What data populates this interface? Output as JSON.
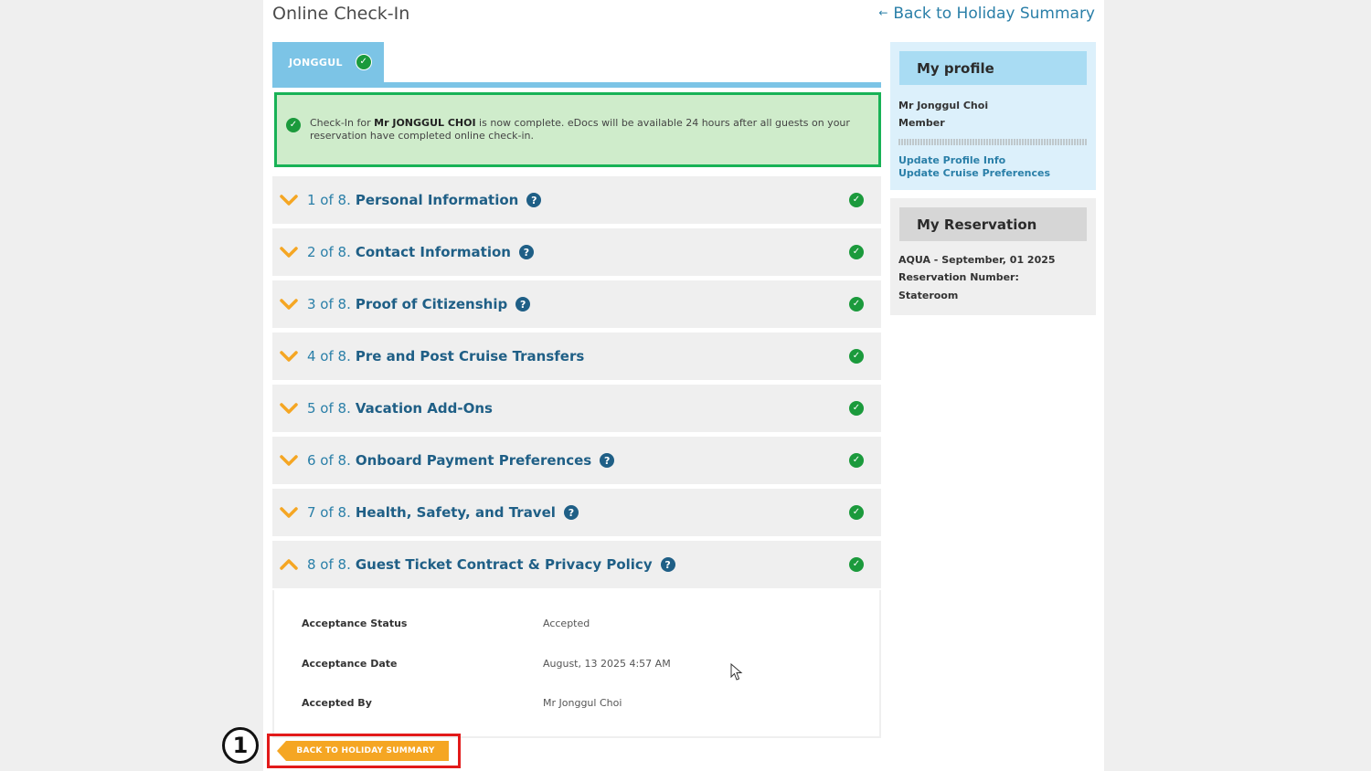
{
  "page": {
    "title": "Online Check-In",
    "back_link": "Back to Holiday Summary"
  },
  "guest_tab": {
    "label": "JONGGUL"
  },
  "banner": {
    "prefix": "Check-In for ",
    "guest_name": "Mr JONGGUL CHOI",
    "suffix": " is now complete. eDocs will be available 24 hours after all guests on your reservation have completed online check-in."
  },
  "steps": [
    {
      "num": "1 of 8.",
      "title": "Personal Information",
      "help": true
    },
    {
      "num": "2 of 8.",
      "title": "Contact Information",
      "help": true
    },
    {
      "num": "3 of 8.",
      "title": "Proof of Citizenship",
      "help": true
    },
    {
      "num": "4 of 8.",
      "title": "Pre and Post Cruise Transfers",
      "help": false
    },
    {
      "num": "5 of 8.",
      "title": "Vacation Add-Ons",
      "help": false
    },
    {
      "num": "6 of 8.",
      "title": "Onboard Payment Preferences",
      "help": true
    },
    {
      "num": "7 of 8.",
      "title": "Health, Safety, and Travel",
      "help": true
    },
    {
      "num": "8 of 8.",
      "title": "Guest Ticket Contract & Privacy Policy",
      "help": true,
      "expanded": true
    }
  ],
  "details": {
    "acceptance_status_label": "Acceptance Status",
    "acceptance_status_value": "Accepted",
    "acceptance_date_label": "Acceptance Date",
    "acceptance_date_value": "August, 13 2025 4:57 AM",
    "accepted_by_label": "Accepted By",
    "accepted_by_value": "Mr Jonggul Choi"
  },
  "bottom_button": {
    "label": "BACK TO HOLIDAY SUMMARY",
    "marker": "1"
  },
  "profile": {
    "title": "My profile",
    "name": "Mr Jonggul Choi",
    "status": "Member",
    "update_profile": "Update Profile Info",
    "update_preferences": "Update Cruise Preferences"
  },
  "reservation": {
    "title": "My Reservation",
    "ship_date": "AQUA - September, 01 2025",
    "reservation_number_label": "Reservation Number:",
    "stateroom_label": "Stateroom"
  },
  "colors": {
    "accent_blue": "#2a7fa8",
    "tab_blue": "#7cc4e6",
    "success_green": "#1b9a3c",
    "chevron_orange": "#f5a623",
    "highlight_red": "#e21a1a"
  }
}
